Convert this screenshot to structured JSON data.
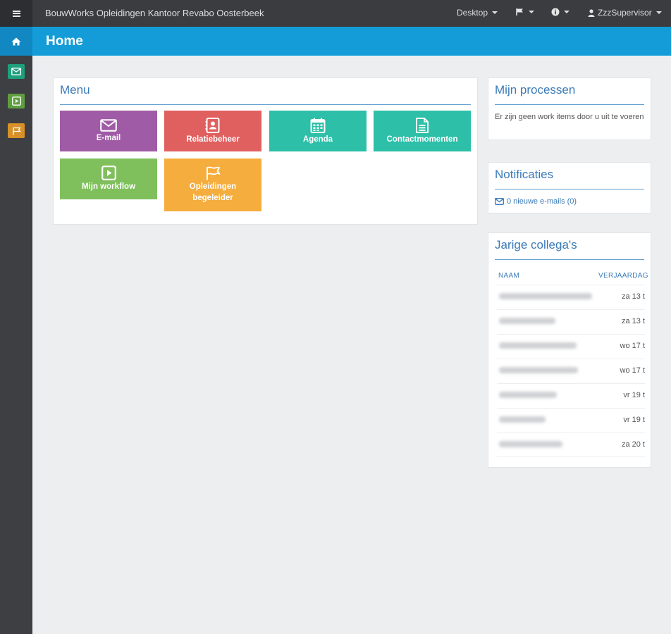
{
  "topbar": {
    "app_title": "BouwWorks Opleidingen Kantoor Revabo Oosterbeek",
    "desktop_label": "Desktop",
    "user_label": "ZzzSupervisor"
  },
  "header": {
    "title": "Home"
  },
  "menu": {
    "title": "Menu",
    "tiles": [
      {
        "label": "E-mail",
        "color": "#a05ba6",
        "icon": "envelope-icon"
      },
      {
        "label": "Relatiebeheer",
        "color": "#e06060",
        "icon": "contact-book-icon"
      },
      {
        "label": "Agenda",
        "color": "#2dbfa7",
        "icon": "calendar-icon"
      },
      {
        "label": "Contactmomenten",
        "color": "#2dbfa7",
        "icon": "document-icon"
      },
      {
        "label": "Mijn workflow",
        "color": "#7fbf5c",
        "icon": "play-square-icon"
      },
      {
        "label": "Opleidingen begeleider",
        "color": "#f5ad3d",
        "icon": "flag-icon"
      }
    ]
  },
  "processen": {
    "title": "Mijn processen",
    "text": "Er zijn geen work items door u uit te voeren"
  },
  "notificaties": {
    "title": "Notificaties",
    "link": "0 nieuwe e-mails (0)"
  },
  "jarige": {
    "title": "Jarige collega's",
    "col_name": "NAAM",
    "col_date": "VERJAARDAG",
    "rows": [
      {
        "date": "za 13 t"
      },
      {
        "date": "za 13 t"
      },
      {
        "date": "wo 17 t"
      },
      {
        "date": "wo 17 t"
      },
      {
        "date": "vr 19 t"
      },
      {
        "date": "vr 19 t"
      },
      {
        "date": "za 20 t"
      }
    ]
  },
  "sidebar": {
    "buttons": [
      {
        "icon": "envelope-icon",
        "color": "#1e9f7e"
      },
      {
        "icon": "play-square-icon",
        "color": "#5f9e3f"
      },
      {
        "icon": "flag-icon",
        "color": "#d89128"
      }
    ]
  }
}
